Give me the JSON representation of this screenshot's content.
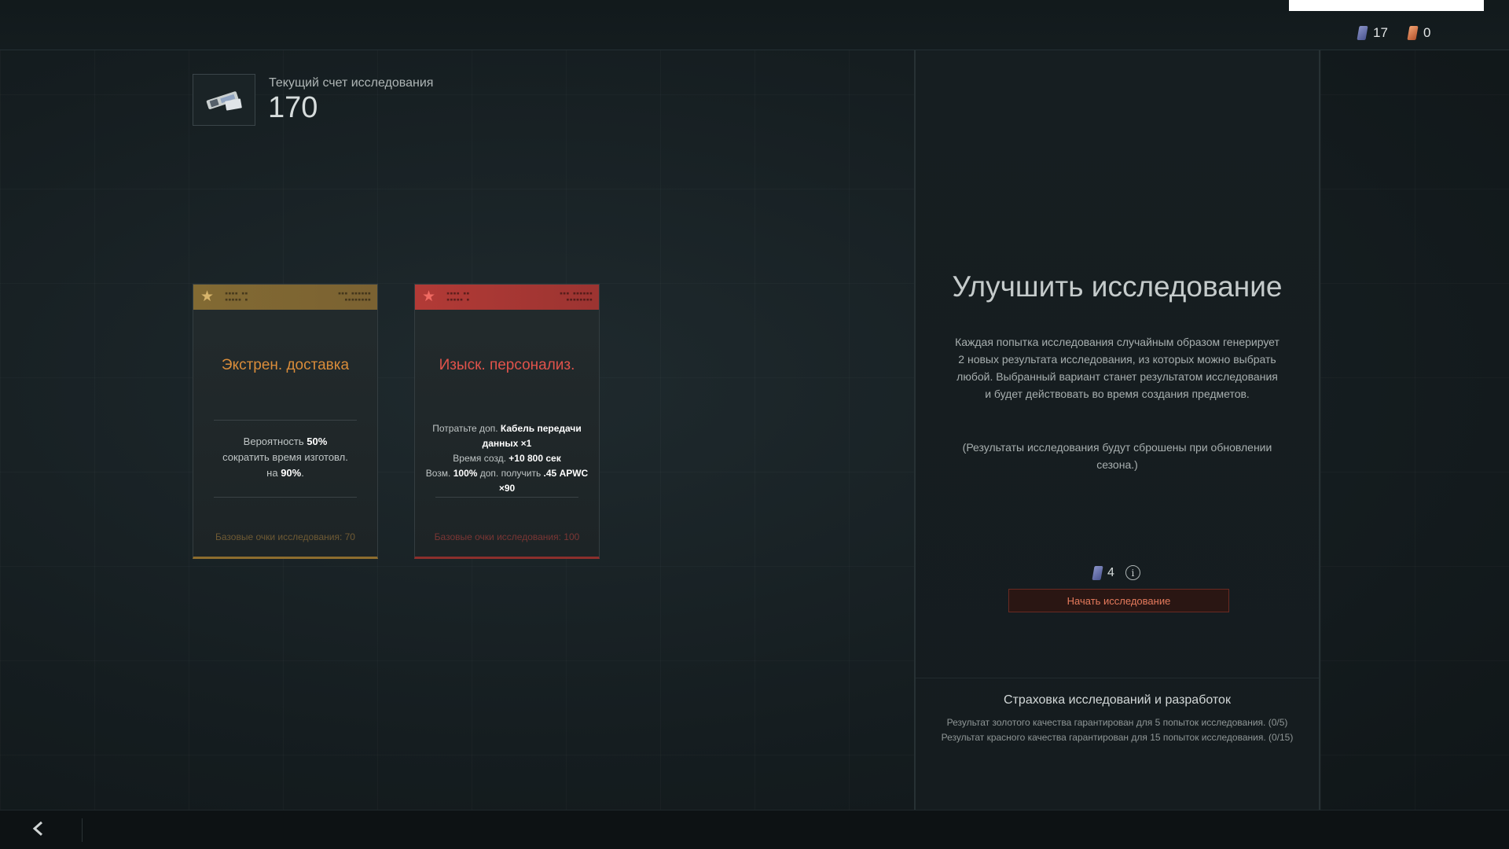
{
  "currencies": [
    {
      "icon": "blue-chip-icon",
      "value": "17"
    },
    {
      "icon": "orange-chip-icon",
      "value": "0"
    }
  ],
  "score": {
    "label": "Текущий счет исследования",
    "value": "170"
  },
  "cards": [
    {
      "quality": "gold",
      "title": "Экстрен. доставка",
      "desc_parts": [
        "Вероятность ",
        "50%",
        " сократить время изготовл. на ",
        "90%",
        "."
      ],
      "footer": "Базовые очки исследования: 70",
      "accent": "#d98c3a"
    },
    {
      "quality": "red",
      "title": "Изыск. персонализ.",
      "line1_a": "Потратьте доп. ",
      "line1_b": "Кабель передачи данных ×1",
      "line2_a": "Время созд. ",
      "line2_b": "+10 800 сек",
      "line3_a": "Возм. ",
      "line3_b": "100%",
      "line3_c": " доп. получить ",
      "line3_d": ".45 APWC ×90",
      "footer": "Базовые очки исследования: 100",
      "accent": "#e0534b"
    }
  ],
  "panel": {
    "title": "Улучшить исследование",
    "description": "Каждая попытка исследования случайным образом генерирует 2 новых результата исследования, из которых можно выбрать любой. Выбранный вариант станет результатом исследования и будет действовать во время создания предметов.",
    "note": "(Результаты исследования будут сброшены при обновлении сезона.)",
    "cost": "4",
    "start_label": "Начать исследование",
    "insurance_title": "Страховка исследований и разработок",
    "insurance_lines": [
      "Результат золотого качества гарантирован для 5 попыток исследования. (0/5)",
      "Результат красного качества гарантирован для 15 попыток исследования. (0/15)"
    ]
  },
  "colors": {
    "gold": "#826a33",
    "red": "#b23a36",
    "button_text": "#e57a5c"
  }
}
